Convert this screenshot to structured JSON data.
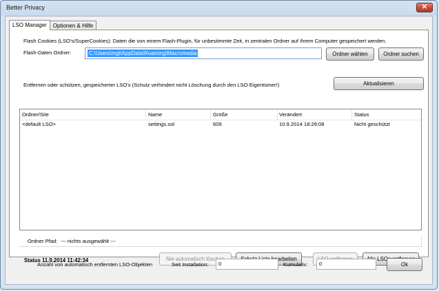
{
  "window": {
    "title": "Better Privacy",
    "close_glyph": "✕"
  },
  "tabs": [
    {
      "label": "LSO Manager",
      "active": true
    },
    {
      "label": "Optionen & Hilfe",
      "active": false
    }
  ],
  "manager": {
    "description": "Flash Cookies (LSO's/SuperCookies): Daten die von einem Flash-Plugin, für unbestimmte Zeit, in zentralen Ordner auf Ihrem Computer gespeichert werden.",
    "folder_label": "Flash-Daten Ordner:",
    "folder_value": "C:\\Users\\mgt\\AppData\\Roaming\\Macromedia",
    "choose_folder_button": "Ordner wählen",
    "search_folder_button": "Ordner suchen",
    "protect_note": "Entfernen oder schützen, gespeicherter LSO's (Schutz verhindert nicht Löschung durch den LSO Eigentümer!)",
    "refresh_button": "Aktualisieren"
  },
  "table": {
    "columns": [
      "Ordner/Site",
      "Name",
      "Größe",
      "Verändert",
      "Status"
    ],
    "rows": [
      {
        "site": "<default LSO>",
        "name": "settings.sol",
        "size": "609",
        "modified": "10.9.2014 18:29:08",
        "status": "Nicht geschützt"
      }
    ]
  },
  "path": {
    "label": "Ordner Pfad:",
    "value": "--- nichts ausgewählt ---"
  },
  "status_text": "Status 11.9.2014 11:42:34",
  "actions": {
    "no_auto_delete": "Nie automatisch löschen",
    "edit_protect_list": "Schutz Liste bearbeiten",
    "remove_lso": "LSO entfernen",
    "remove_all": "Alle LSOs entfernen"
  },
  "footer": {
    "count_label": "Anzahl von automatisch entfernten LSO-Objekten",
    "since_install_label": "Seit Installation:",
    "since_install_value": "0",
    "cumulative_label": "Kumulativ:",
    "cumulative_value": "0",
    "ok_button": "Ok"
  }
}
